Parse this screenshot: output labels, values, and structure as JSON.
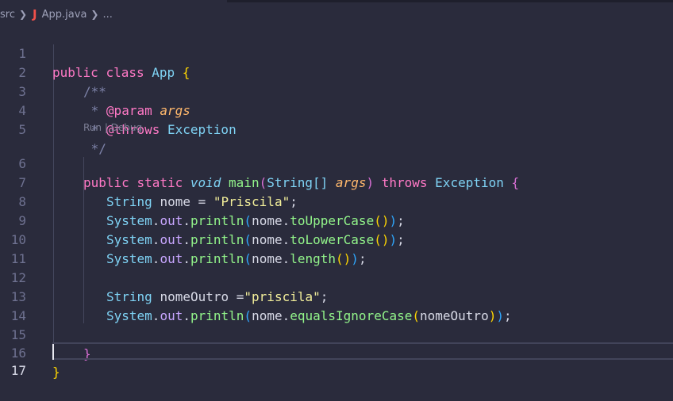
{
  "breadcrumb": {
    "folder": "src",
    "file": "App.java",
    "more": "..."
  },
  "codelens": "Run | Debug",
  "lines": [
    {
      "n": "1"
    },
    {
      "n": "2"
    },
    {
      "n": "3"
    },
    {
      "n": "4"
    },
    {
      "n": "5"
    },
    {
      "n": "6"
    },
    {
      "n": "7"
    },
    {
      "n": "8"
    },
    {
      "n": "9"
    },
    {
      "n": "10"
    },
    {
      "n": "11"
    },
    {
      "n": "12"
    },
    {
      "n": "13"
    },
    {
      "n": "14"
    },
    {
      "n": "15"
    },
    {
      "n": "16"
    },
    {
      "n": "17"
    }
  ],
  "code": {
    "l1": [
      "public",
      "class",
      "App",
      "{"
    ],
    "l2": "/**",
    "l3": [
      "*",
      "@param",
      "args"
    ],
    "l4": [
      "*",
      "@throws",
      "Exception"
    ],
    "l5": "*/",
    "l6": [
      "public",
      "static",
      "void",
      "main",
      "String[]",
      "args",
      "throws",
      "Exception",
      "{"
    ],
    "l7": [
      "String",
      "nome",
      "\"Priscila\""
    ],
    "l8": [
      "System",
      "out",
      "println",
      "nome",
      "toUpperCase"
    ],
    "l9": [
      "System",
      "out",
      "println",
      "nome",
      "toLowerCase"
    ],
    "l10": [
      "System",
      "out",
      "println",
      "nome",
      "length"
    ],
    "l12": [
      "String",
      "nomeOutro",
      "\"priscila\""
    ],
    "l13": [
      "System",
      "out",
      "println",
      "nome",
      "equalsIgnoreCase",
      "nomeOutro"
    ],
    "l15": "}",
    "l16": "}"
  },
  "colors": {
    "background": "#2a2b3c",
    "keyword": "#ff79c6",
    "class": "#7fd3f5",
    "function": "#92f48a",
    "string": "#f2ee9a",
    "parameter": "#ffb86c"
  }
}
